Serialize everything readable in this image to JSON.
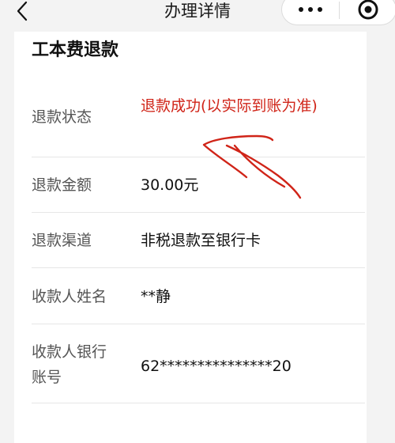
{
  "nav": {
    "title": "办理详情",
    "back_icon": "chevron-left-icon",
    "more_icon": "more-dots-icon",
    "close_icon": "target-close-icon"
  },
  "card": {
    "title": "工本费退款",
    "rows": [
      {
        "label": "退款状态",
        "value": "退款成功(以实际到账为准)",
        "value_color": "#d02418"
      },
      {
        "label": "退款金额",
        "value": "30.00元"
      },
      {
        "label": "退款渠道",
        "value": "非税退款至银行卡"
      },
      {
        "label": "收款人姓名",
        "value": "**静"
      },
      {
        "label": "收款人银行账号",
        "value": "62***************20"
      }
    ]
  },
  "annotation": {
    "color": "#d02418"
  }
}
